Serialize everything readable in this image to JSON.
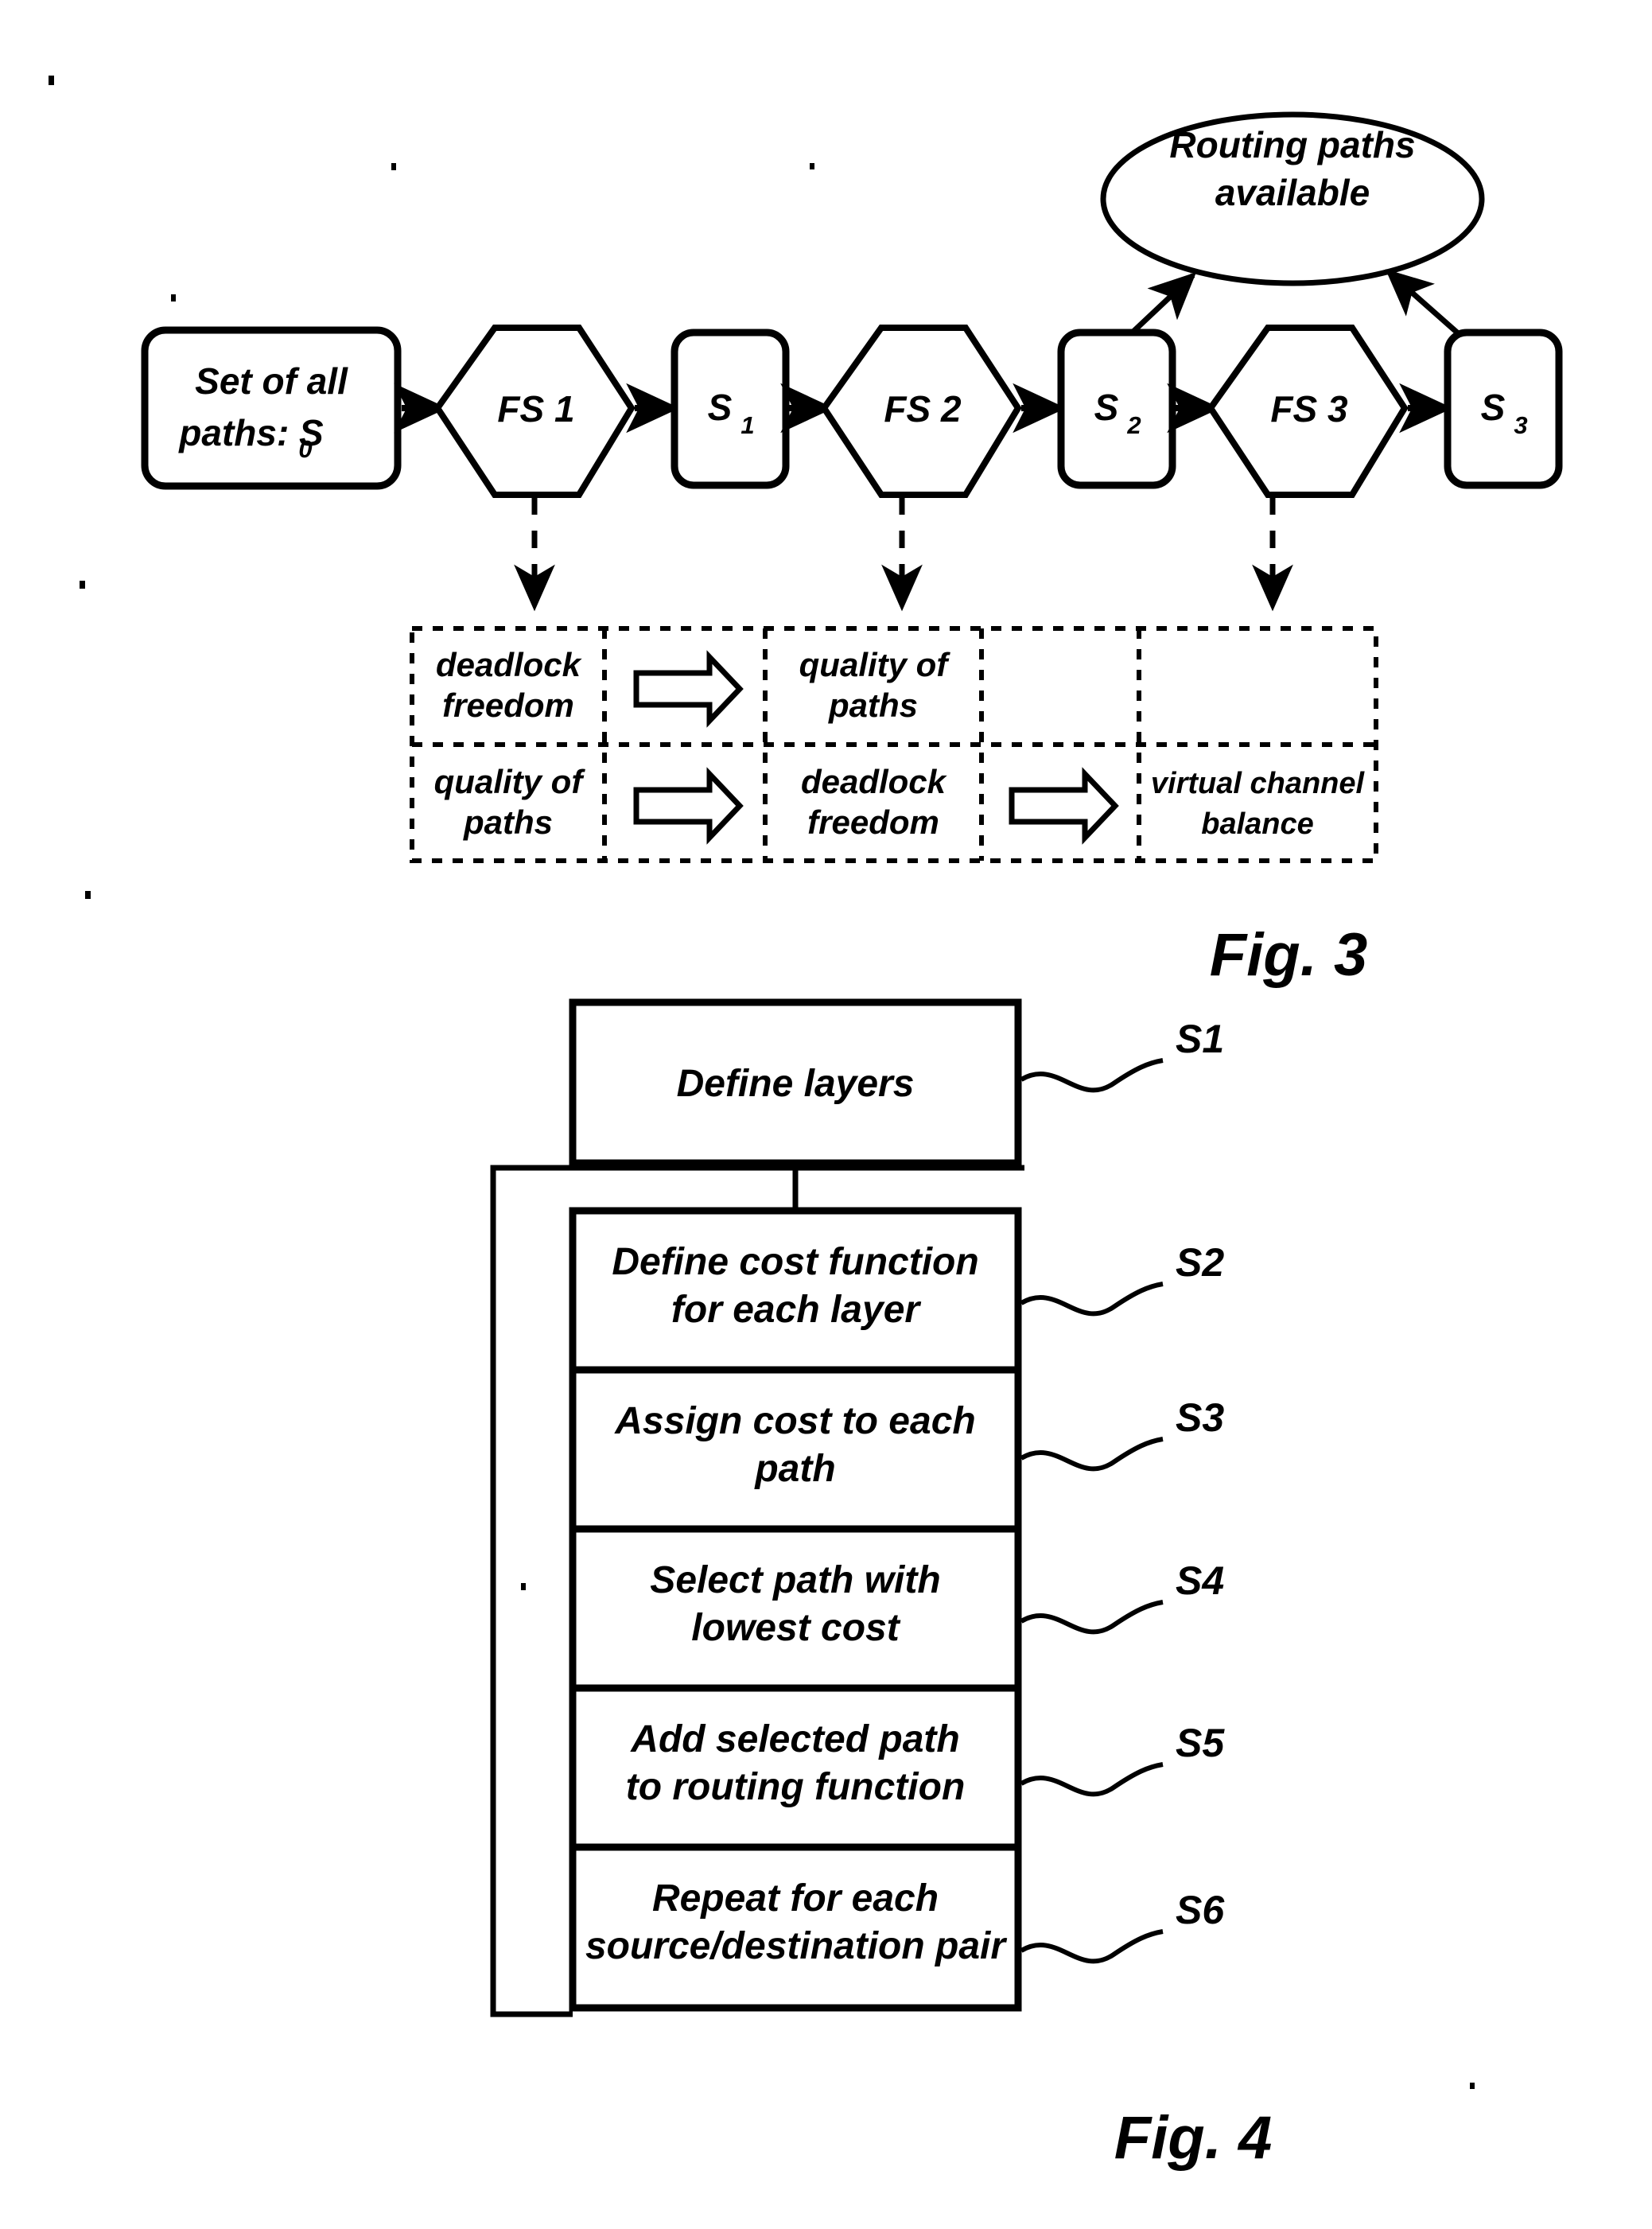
{
  "figure3": {
    "caption": "Fig. 3",
    "start_box": {
      "line1": "Set of all",
      "line2_pre": "paths: S",
      "line2_sub": "0"
    },
    "terminal_ellipse": {
      "line1": "Routing paths",
      "line2": "available"
    },
    "pipeline": [
      {
        "type": "filter-stage",
        "label": "FS 1"
      },
      {
        "type": "state",
        "label": "S",
        "subscript": "1"
      },
      {
        "type": "filter-stage",
        "label": "FS 2"
      },
      {
        "type": "state",
        "label": "S",
        "subscript": "2"
      },
      {
        "type": "filter-stage",
        "label": "FS 3"
      },
      {
        "type": "state",
        "label": "S",
        "subscript": "3"
      }
    ],
    "criteria_table": {
      "rows": [
        {
          "cells": [
            {
              "kind": "text",
              "line1": "deadlock",
              "line2": "freedom"
            },
            {
              "kind": "arrow",
              "glyph": "block-arrow-right"
            },
            {
              "kind": "text",
              "line1": "quality of",
              "line2": "paths"
            },
            {
              "kind": "empty"
            },
            {
              "kind": "empty"
            }
          ]
        },
        {
          "cells": [
            {
              "kind": "text",
              "line1": "quality of",
              "line2": "paths"
            },
            {
              "kind": "arrow",
              "glyph": "block-arrow-right"
            },
            {
              "kind": "text",
              "line1": "deadlock",
              "line2": "freedom"
            },
            {
              "kind": "arrow",
              "glyph": "block-arrow-right"
            },
            {
              "kind": "text",
              "line1": "virtual channel",
              "line2": "balance"
            }
          ]
        }
      ]
    }
  },
  "figure4": {
    "caption": "Fig. 4",
    "steps": [
      {
        "id": "S1",
        "line1": "Define layers",
        "line2": ""
      },
      {
        "id": "S2",
        "line1": "Define cost function",
        "line2": "for each layer"
      },
      {
        "id": "S3",
        "line1": "Assign cost to each",
        "line2": "path"
      },
      {
        "id": "S4",
        "line1": "Select path with",
        "line2": "lowest cost"
      },
      {
        "id": "S5",
        "line1": "Add selected path",
        "line2": "to routing function"
      },
      {
        "id": "S6",
        "line1": "Repeat for each",
        "line2": "source/destination pair"
      }
    ]
  },
  "colors": {
    "ink": "#000000",
    "paper": "#ffffff"
  }
}
